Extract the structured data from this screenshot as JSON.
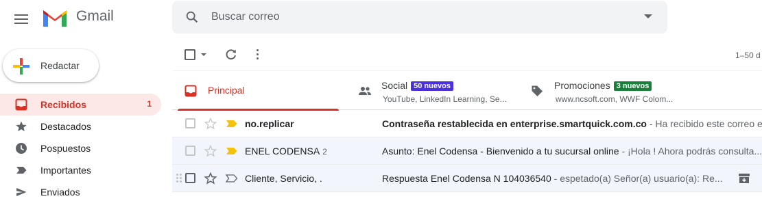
{
  "app": {
    "name": "Gmail"
  },
  "search": {
    "placeholder": "Buscar correo"
  },
  "compose": {
    "label": "Redactar"
  },
  "sidebar": {
    "items": [
      {
        "label": "Recibidos",
        "count": "1",
        "icon": "inbox-icon",
        "active": true
      },
      {
        "label": "Destacados",
        "count": "",
        "icon": "star-icon"
      },
      {
        "label": "Pospuestos",
        "count": "",
        "icon": "clock-icon"
      },
      {
        "label": "Importantes",
        "count": "",
        "icon": "label-important-icon"
      },
      {
        "label": "Enviados",
        "count": "",
        "icon": "send-icon"
      }
    ]
  },
  "toolbar": {
    "pager": "1–50 d"
  },
  "tabs": [
    {
      "label": "Principal",
      "icon": "inbox-icon",
      "active": true
    },
    {
      "label": "Social",
      "badge": "50 nuevos",
      "badge_color": "#4b30e0",
      "subtitle": "YouTube, LinkedIn Learning, Se...",
      "icon": "people-icon"
    },
    {
      "label": "Promociones",
      "badge": "3 nuevos",
      "badge_color": "#188038",
      "subtitle": "www.ncsoft.com, WWF Colom...",
      "icon": "tag-icon"
    }
  ],
  "emails": [
    {
      "sender": "no.replicar",
      "count": "",
      "subject": "Contraseña restablecida en enterprise.smartquick.com.co",
      "snippet": " - Ha recibido este correo el...",
      "unread": true,
      "important": true
    },
    {
      "sender": "ENEL CODENSA",
      "count": "2",
      "subject": "Asunto: Enel Codensa - Bienvenido a tu sucursal online",
      "snippet": " - ¡Hola ! Ahora podrás consulta...",
      "unread": false,
      "important": true
    },
    {
      "sender": "Cliente, Servicio, .",
      "count": "",
      "subject": "Respuesta Enel Codensa N 104036540",
      "snippet": " - espetado(a) Señor(a) usuario(a): Re...",
      "unread": false,
      "important": false
    }
  ],
  "colors": {
    "brand_red": "#d93025",
    "important_yellow": "#f4c20d",
    "icon_gray": "#5f6368"
  }
}
